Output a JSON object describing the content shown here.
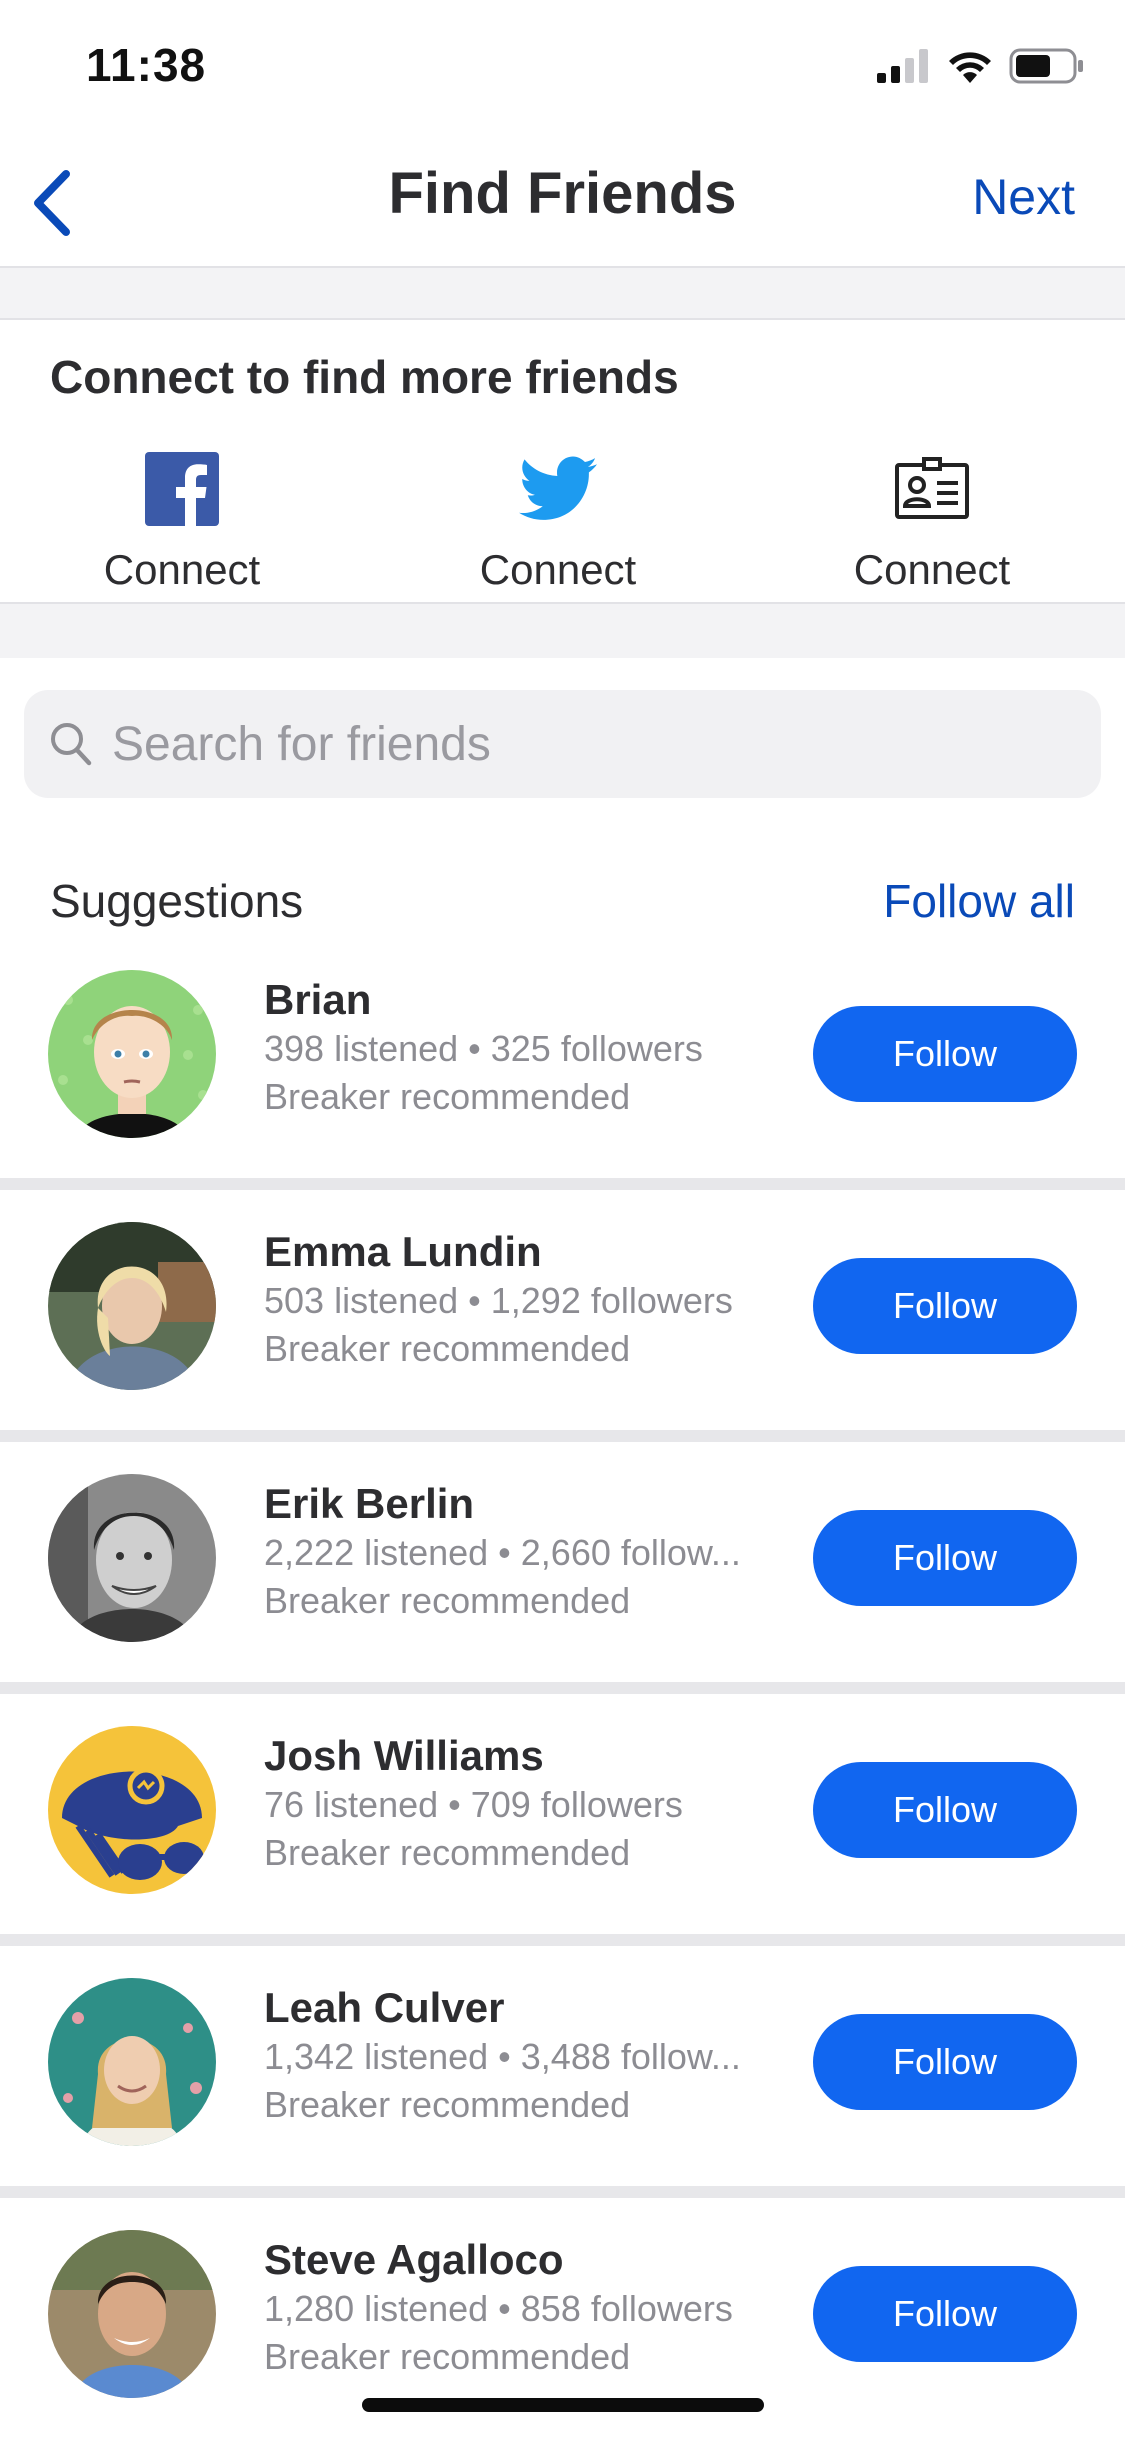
{
  "status_bar": {
    "time": "11:38",
    "icons": [
      "cellular-signal-icon",
      "wifi-icon",
      "battery-icon"
    ]
  },
  "nav": {
    "back_icon": "chevron-left-icon",
    "title": "Find Friends",
    "next_label": "Next"
  },
  "connect": {
    "heading": "Connect to find more friends",
    "options": [
      {
        "icon": "facebook-icon",
        "label": "Connect"
      },
      {
        "icon": "twitter-icon",
        "label": "Connect"
      },
      {
        "icon": "contacts-card-icon",
        "label": "Connect"
      }
    ]
  },
  "search": {
    "placeholder": "Search for friends",
    "value": ""
  },
  "suggestions": {
    "title": "Suggestions",
    "follow_all_label": "Follow all",
    "people": [
      {
        "name": "Brian",
        "stats": "398 listened • 325 followers",
        "reason": "Breaker recommended",
        "button": "Follow"
      },
      {
        "name": "Emma Lundin",
        "stats": "503 listened • 1,292 followers",
        "reason": "Breaker recommended",
        "button": "Follow"
      },
      {
        "name": "Erik Berlin",
        "stats": "2,222 listened • 2,660 follow...",
        "reason": "Breaker recommended",
        "button": "Follow"
      },
      {
        "name": "Josh Williams",
        "stats": "76 listened • 709 followers",
        "reason": "Breaker recommended",
        "button": "Follow"
      },
      {
        "name": "Leah Culver",
        "stats": "1,342 listened • 3,488 follow...",
        "reason": "Breaker recommended",
        "button": "Follow"
      },
      {
        "name": "Steve Agalloco",
        "stats": "1,280 listened • 858 followers",
        "reason": "Breaker recommended",
        "button": "Follow"
      }
    ]
  },
  "colors": {
    "accent": "#0a4ab8",
    "follow_button": "#1166f0",
    "facebook": "#3b5aa8",
    "twitter": "#1d9bf0"
  }
}
